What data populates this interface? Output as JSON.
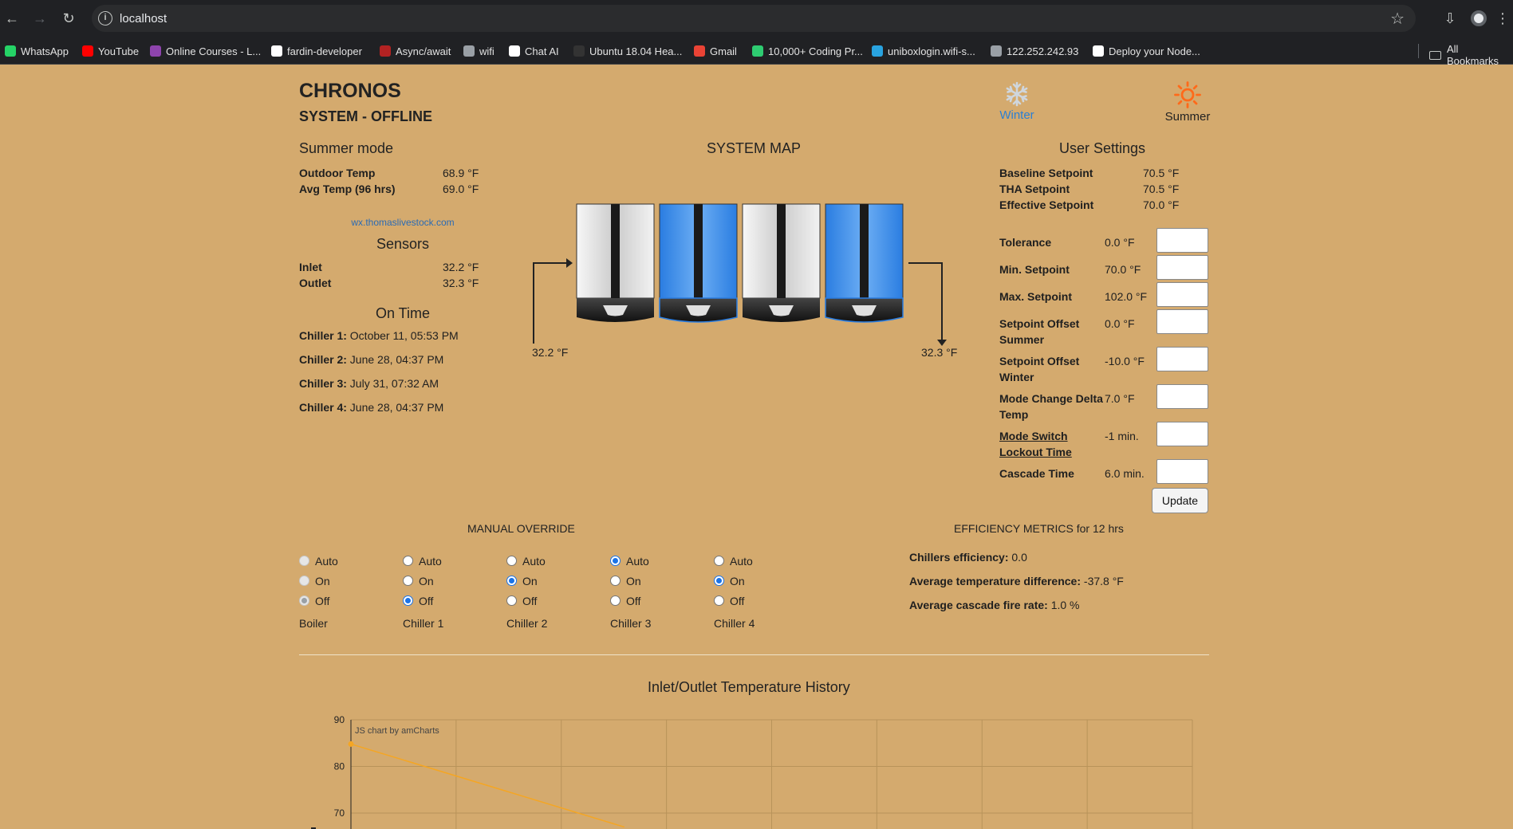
{
  "browser": {
    "url": "localhost",
    "bookmarks": [
      {
        "label": "WhatsApp",
        "color": "#25d366"
      },
      {
        "label": "YouTube",
        "color": "#ff0000"
      },
      {
        "label": "Online Courses - L...",
        "color": "#8e44ad"
      },
      {
        "label": "fardin-developer",
        "color": "#ffffff"
      },
      {
        "label": "Async/await",
        "color": "#b22222"
      },
      {
        "label": "wifi",
        "color": "#9aa0a6"
      },
      {
        "label": "Chat AI",
        "color": "#ffffff"
      },
      {
        "label": "Ubuntu 18.04 Hea...",
        "color": "#333333"
      },
      {
        "label": "Gmail",
        "color": "#ea4335"
      },
      {
        "label": "10,000+ Coding Pr...",
        "color": "#2ecc71"
      },
      {
        "label": "uniboxlogin.wifi-s...",
        "color": "#29a3e0"
      },
      {
        "label": "122.252.242.93",
        "color": "#9aa0a6"
      },
      {
        "label": "Deploy your Node...",
        "color": "#ffffff"
      }
    ],
    "all_bookmarks": "All Bookmarks"
  },
  "header": {
    "title": "CHRONOS",
    "status": "SYSTEM - OFFLINE",
    "winter_label": "Winter",
    "summer_label": "Summer",
    "winter_color": "#2a7fd4",
    "summer_color": "#ff6a1a"
  },
  "mode": {
    "title": "Summer mode",
    "rows": [
      {
        "label": "Outdoor Temp",
        "value": "68.9 °F"
      },
      {
        "label": "Avg Temp (96 hrs)",
        "value": "69.0 °F"
      }
    ],
    "link": "wx.thomaslivestock.com"
  },
  "sensors": {
    "title": "Sensors",
    "rows": [
      {
        "label": "Inlet",
        "value": "32.2 °F"
      },
      {
        "label": "Outlet",
        "value": "32.3 °F"
      }
    ]
  },
  "on_time": {
    "title": "On Time",
    "rows": [
      {
        "label": "Chiller 1:",
        "value": "October 11, 05:53 PM"
      },
      {
        "label": "Chiller 2:",
        "value": "June 28, 04:37 PM"
      },
      {
        "label": "Chiller 3:",
        "value": "July 31, 07:32 AM"
      },
      {
        "label": "Chiller 4:",
        "value": "June 28, 04:37 PM"
      }
    ]
  },
  "system_map": {
    "title": "SYSTEM MAP",
    "inlet_label": "32.2 °F",
    "outlet_label": "32.3 °F",
    "units": [
      {
        "state": "off",
        "color": "#e8e8e8"
      },
      {
        "state": "on",
        "color": "#2a7de1"
      },
      {
        "state": "off",
        "color": "#e8e8e8"
      },
      {
        "state": "on",
        "color": "#2a7de1"
      }
    ]
  },
  "user_settings": {
    "title": "User Settings",
    "rows": [
      {
        "label": "Baseline Setpoint",
        "value": "70.5 °F"
      },
      {
        "label": "THA Setpoint",
        "value": "70.5 °F"
      },
      {
        "label": "Effective Setpoint",
        "value": "70.0 °F"
      }
    ],
    "editable": [
      {
        "label": "Tolerance",
        "value": "0.0 °F",
        "link": false
      },
      {
        "label": "Min. Setpoint",
        "value": "70.0 °F",
        "link": false
      },
      {
        "label": "Max. Setpoint",
        "value": "102.0 °F",
        "link": false
      },
      {
        "label": "Setpoint Offset Summer",
        "value": "0.0 °F",
        "link": false
      },
      {
        "label": "Setpoint Offset Winter",
        "value": "-10.0 °F",
        "link": false
      },
      {
        "label": "Mode Change Delta Temp",
        "value": "7.0 °F",
        "link": false
      },
      {
        "label": "Mode Switch Lockout Time",
        "value": "-1 min.",
        "link": true
      },
      {
        "label": "Cascade Time",
        "value": "6.0 min.",
        "link": false
      }
    ],
    "update_label": "Update"
  },
  "manual_override": {
    "title": "MANUAL OVERRIDE",
    "option_labels": [
      "Auto",
      "On",
      "Off"
    ],
    "devices": [
      {
        "name": "Boiler",
        "selected": "Off",
        "disabled": true
      },
      {
        "name": "Chiller 1",
        "selected": "Off",
        "disabled": false
      },
      {
        "name": "Chiller 2",
        "selected": "On",
        "disabled": false
      },
      {
        "name": "Chiller 3",
        "selected": "Auto",
        "disabled": false
      },
      {
        "name": "Chiller 4",
        "selected": "On",
        "disabled": false
      }
    ]
  },
  "efficiency": {
    "title": "EFFICIENCY METRICS for 12 hrs",
    "rows": [
      {
        "label": "Chillers efficiency:",
        "value": "0.0"
      },
      {
        "label": "Average temperature difference:",
        "value": "-37.8 °F"
      },
      {
        "label": "Average cascade fire rate:",
        "value": "1.0 %"
      }
    ]
  },
  "chart_data": {
    "type": "line",
    "title": "Inlet/Outlet Temperature History",
    "credit": "JS chart by amCharts",
    "y_ticks": [
      90,
      80,
      70
    ],
    "ylim": [
      67,
      90
    ],
    "x_grid_count": 8,
    "series": [
      {
        "color": "#f5a623",
        "points": [
          [
            0,
            84.8
          ],
          [
            2.6,
            67.0
          ]
        ]
      }
    ],
    "grid": true
  }
}
